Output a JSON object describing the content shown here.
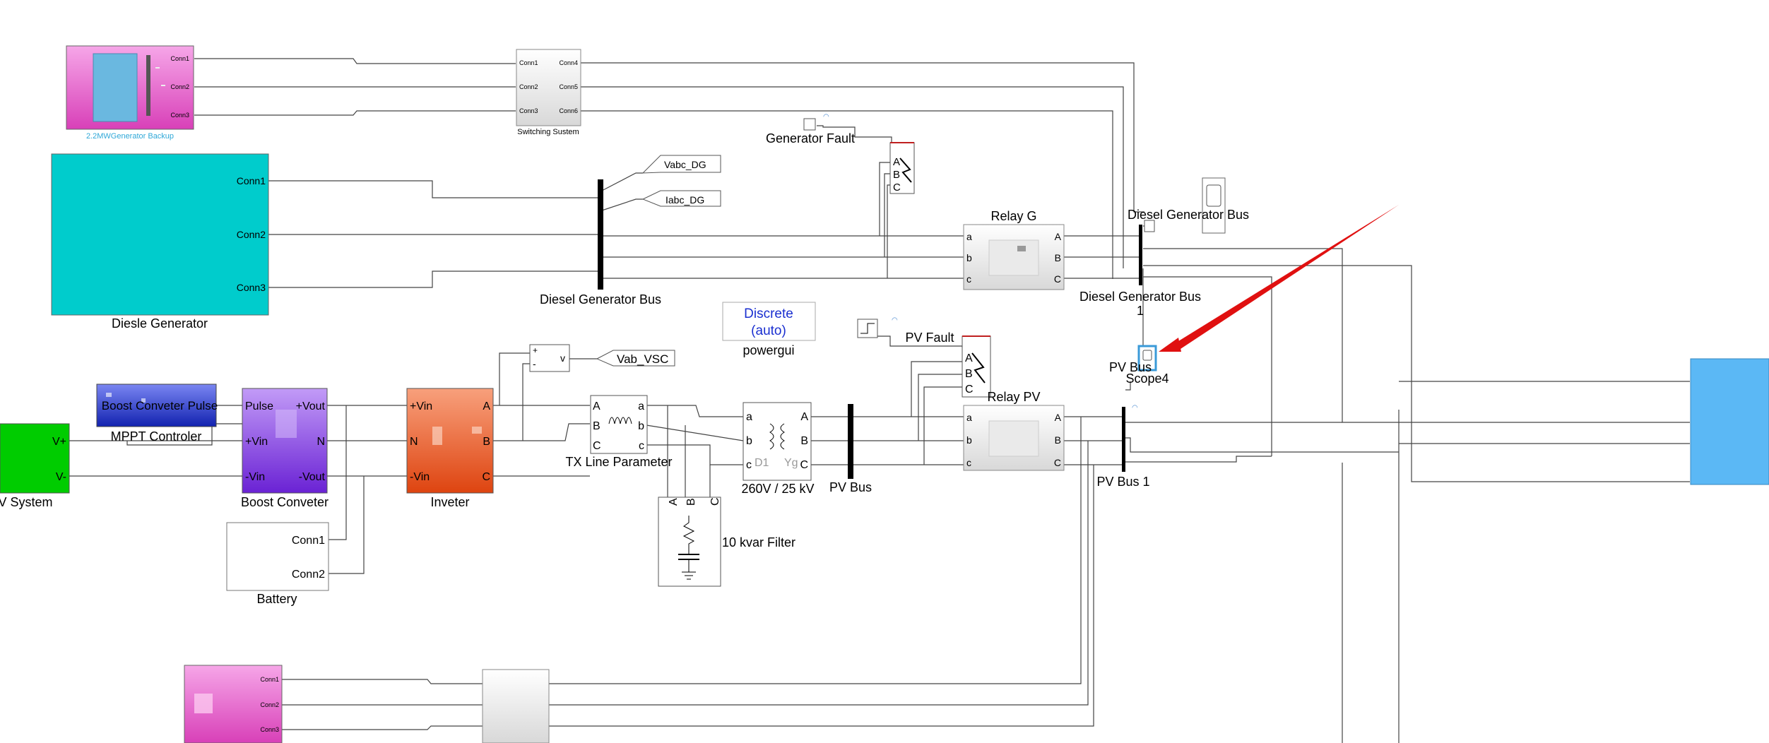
{
  "model": {
    "blocks": {
      "generator_backup": {
        "label": "2.2MWGenerator Backup",
        "ports": [
          "Conn1",
          "Conn2",
          "Conn3"
        ]
      },
      "switching_system": {
        "label": "Switching Sustem",
        "ports_left": [
          "Conn1",
          "Conn2",
          "Conn3"
        ],
        "ports_right": [
          "Conn4",
          "Conn5",
          "Conn6"
        ]
      },
      "diesel_generator": {
        "label": "Diesle Generator",
        "ports": [
          "Conn1",
          "Conn2",
          "Conn3"
        ]
      },
      "diesel_bus": {
        "label": "Diesel Generator Bus"
      },
      "diesel_bus_1": {
        "label_line1": "Diesel Generator Bus",
        "label_line2": "1"
      },
      "vabc_dg": {
        "label": "Vabc_DG"
      },
      "iabc_dg": {
        "label": "Iabc_DG"
      },
      "generator_fault": {
        "label": "Generator Fault",
        "ports": [
          "A",
          "B",
          "C"
        ]
      },
      "relay_g": {
        "label": "Relay G",
        "ports_left": [
          "a",
          "b",
          "c"
        ],
        "ports_right": [
          "A",
          "B",
          "C"
        ]
      },
      "diesel_scope": {
        "label": "Diesel Generator Bus"
      },
      "powergui": {
        "line1": "Discrete",
        "line2": "(auto)",
        "label": "powergui"
      },
      "pv_fault": {
        "label": "PV Fault",
        "ports": [
          "A",
          "B",
          "C"
        ]
      },
      "relay_pv": {
        "label": "Relay PV",
        "ports_left": [
          "a",
          "b",
          "c"
        ],
        "ports_right": [
          "A",
          "B",
          "C"
        ]
      },
      "scope4": {
        "label_top": "PV Bus",
        "label": "Scope4"
      },
      "mppt": {
        "label": "MPPT Controler",
        "text": "Boost Conveter Pulse"
      },
      "pv_system": {
        "label": "V System",
        "ports": [
          "V+",
          "V-"
        ]
      },
      "boost": {
        "label": "Boost Conveter",
        "ports_left": [
          "Pulse",
          "+Vin",
          "-Vin"
        ],
        "ports_right": [
          "+Vout",
          "N",
          "-Vout"
        ]
      },
      "inverter": {
        "label": "Inveter",
        "ports_left": [
          "+Vin",
          "N",
          "-Vin"
        ],
        "ports_right": [
          "A",
          "B",
          "C"
        ]
      },
      "vab_meter": {
        "port_in_pos": "+",
        "port_in_neg": "-",
        "port_out": "v",
        "label": "Vab_VSC"
      },
      "tx_line": {
        "label": "TX Line Parameter",
        "ports_left": [
          "A",
          "B",
          "C"
        ],
        "ports_right": [
          "a",
          "b",
          "c"
        ]
      },
      "transformer": {
        "label": "260V / 25 kV",
        "ports_left": [
          "a",
          "b",
          "c"
        ],
        "ports_right": [
          "A",
          "B",
          "C"
        ],
        "winding1": "D1",
        "winding2": "Yg"
      },
      "pv_bus": {
        "label": "PV Bus"
      },
      "pv_bus_1": {
        "label": "PV Bus 1"
      },
      "filter": {
        "label": "10 kvar Filter",
        "ports": [
          "A",
          "B",
          "C"
        ]
      },
      "battery": {
        "label": "Battery",
        "ports": [
          "Conn1",
          "Conn2"
        ]
      },
      "load_block": {
        "label": ""
      },
      "bottom_gen": {
        "ports": [
          "Conn1",
          "Conn2",
          "Conn3"
        ]
      }
    }
  },
  "colors": {
    "pink_top": "#f6a0e6",
    "pink_bottom": "#d444b8",
    "cyan": "#00cccc",
    "green": "#00cc00",
    "purple_top": "#b98af5",
    "purple_bottom": "#6f25d8",
    "orange_top": "#f79a73",
    "orange_bottom": "#e04812",
    "blue_mppt_top": "#6e7cf0",
    "blue_mppt_bottom": "#1626b8",
    "sky": "#5bb8f5",
    "arrow": "#e01010",
    "powergui_text": "#1a2fd0",
    "backup_label": "#2fa8d8"
  }
}
